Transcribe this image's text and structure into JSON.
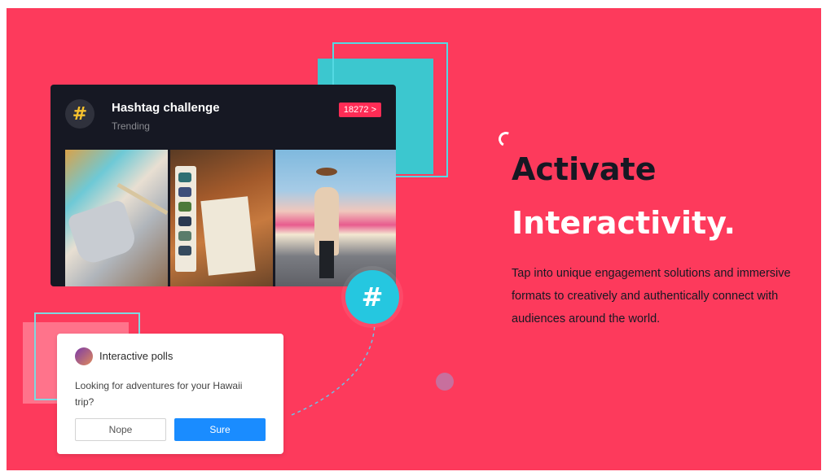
{
  "hashtag_card": {
    "icon": "#",
    "title": "Hashtag challenge",
    "subtitle": "Trending",
    "count": "18272 >"
  },
  "hash_badge": "#",
  "poll": {
    "title": "Interactive polls",
    "question": "Looking for adventures for your Hawaii trip?",
    "options": [
      "Nope",
      "Sure"
    ]
  },
  "hero": {
    "headline_line1": "Activate",
    "headline_line2": "Interactivity.",
    "body": "Tap into unique engagement solutions and immersive formats to creatively and authentically connect with audiences around the world."
  },
  "colors": {
    "background": "#fd3a5c",
    "card_dark": "#161823",
    "accent_teal": "#25c7e0",
    "accent_blue": "#1a8cff",
    "hashtag_yellow": "#f7c22e"
  }
}
